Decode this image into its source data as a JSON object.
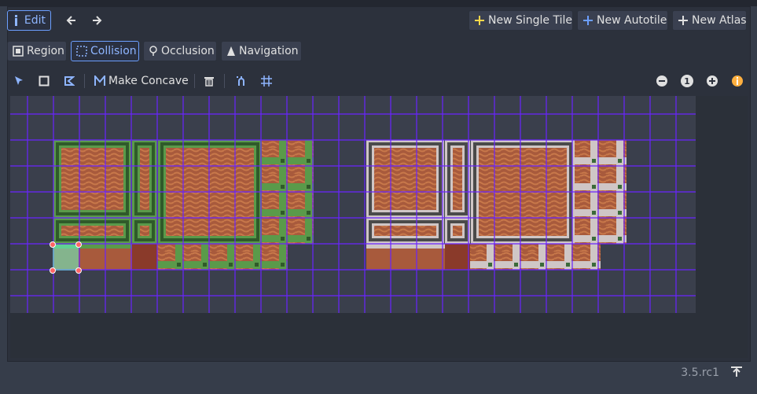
{
  "toolbar_top": {
    "edit_label": "Edit",
    "new_single_tile": "New Single Tile",
    "new_autotile": "New Autotile",
    "new_atlas": "New Atlas"
  },
  "mode_tabs": [
    {
      "label": "Region",
      "icon": "region-icon",
      "selected": false
    },
    {
      "label": "Collision",
      "icon": "collision-icon",
      "selected": true
    },
    {
      "label": "Occlusion",
      "icon": "occlusion-icon",
      "selected": false
    },
    {
      "label": "Navigation",
      "icon": "navigation-icon",
      "selected": false
    }
  ],
  "tools": {
    "make_concave_label": "Make Concave",
    "zoom_reset_label": "1"
  },
  "footer": {
    "version": "3.5.rc1"
  },
  "colors": {
    "accent": "#6c9fff",
    "grid": "#6a24ff",
    "selection": "#66ffd0",
    "handle": "#ff6464",
    "warning": "#ffb040",
    "plus_yellow": "#ffd84a"
  }
}
